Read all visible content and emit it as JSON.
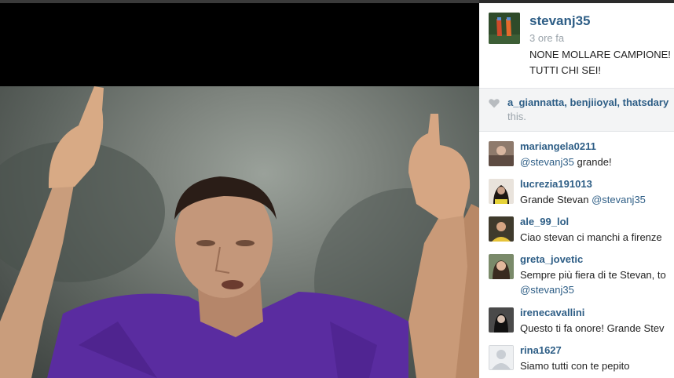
{
  "post": {
    "username": "stevanj35",
    "timestamp": "3 ore fa",
    "caption_line1": "NONE MOLLARE CAMPIONE! H",
    "caption_line2": "TUTTI CHI SEI!"
  },
  "likes": {
    "likers": "a_giannatta, benjiioyal, thatsdary",
    "tail": "this."
  },
  "comments": [
    {
      "user": "mariangela0211",
      "text_mention": "@stevanj35",
      "text_rest": " grande!"
    },
    {
      "user": "lucrezia191013",
      "text_pre": "Grande Stevan ",
      "text_mention": "@stevanj35"
    },
    {
      "user": "ale_99_lol",
      "text": "Ciao stevan ci manchi a firenze"
    },
    {
      "user": "greta_jovetic",
      "text": "Sempre più fiera di te Stevan, to",
      "text_mention": "@stevanj35"
    },
    {
      "user": "irenecavallini",
      "text": "Questo ti fa onore! Grande Stev"
    },
    {
      "user": "rina1627",
      "text": "Siamo tutti con te pepito"
    }
  ],
  "colors": {
    "link": "#2e5e86",
    "muted": "#9aa3aa",
    "likes_bg": "#f3f4f5"
  },
  "icons": {
    "like": "heart-icon"
  }
}
